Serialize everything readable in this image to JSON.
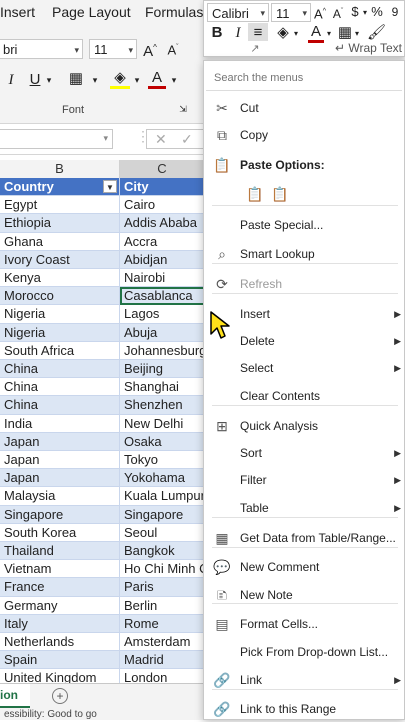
{
  "ribbon": {
    "tabs": [
      "Insert",
      "Page Layout",
      "Formulas"
    ],
    "font_name": "bri",
    "font_size": "11",
    "font_group_label": "Font"
  },
  "mini_toolbar": {
    "font_name": "Calibri",
    "font_size": "11",
    "currency_symbol": "$",
    "percent_symbol": "%",
    "wrap_text_label": "Wrap Text"
  },
  "columns": {
    "b": "B",
    "c": "C"
  },
  "table": {
    "headers": [
      "Country",
      "City"
    ],
    "rows": [
      [
        "Egypt",
        "Cairo"
      ],
      [
        "Ethiopia",
        "Addis Ababa"
      ],
      [
        "Ghana",
        "Accra"
      ],
      [
        "Ivory Coast",
        "Abidjan"
      ],
      [
        "Kenya",
        "Nairobi"
      ],
      [
        "Morocco",
        "Casablanca"
      ],
      [
        "Nigeria",
        "Lagos"
      ],
      [
        "Nigeria",
        "Abuja"
      ],
      [
        "South Africa",
        "Johannesburg"
      ],
      [
        "China",
        "Beijing"
      ],
      [
        "China",
        "Shanghai"
      ],
      [
        "China",
        "Shenzhen"
      ],
      [
        "India",
        "New Delhi"
      ],
      [
        "Japan",
        "Osaka"
      ],
      [
        "Japan",
        "Tokyo"
      ],
      [
        "Japan",
        "Yokohama"
      ],
      [
        "Malaysia",
        "Kuala Lumpur"
      ],
      [
        "Singapore",
        "Singapore"
      ],
      [
        "South Korea",
        "Seoul"
      ],
      [
        "Thailand",
        "Bangkok"
      ],
      [
        "Vietnam",
        "Ho Chi Minh City"
      ],
      [
        "France",
        "Paris"
      ],
      [
        "Germany",
        "Berlin"
      ],
      [
        "Italy",
        "Rome"
      ],
      [
        "Netherlands",
        "Amsterdam"
      ],
      [
        "Spain",
        "Madrid"
      ],
      [
        "United Kingdom",
        "London"
      ]
    ]
  },
  "sheet": {
    "active_tab_fragment": "ion",
    "add_symbol": "+"
  },
  "status": {
    "accessibility": "essibility: Good to go"
  },
  "menu": {
    "search_placeholder": "Search the menus",
    "items": [
      {
        "label": "Cut",
        "icon": "scissors-icon",
        "glyph": "✂",
        "arrow": false,
        "disabled": false
      },
      {
        "label": "Copy",
        "icon": "copy-icon",
        "glyph": "⧉",
        "arrow": false,
        "disabled": false
      },
      {
        "label": "Paste Options:",
        "icon": "paste-icon",
        "glyph": "📋",
        "arrow": false,
        "disabled": false,
        "bold": true
      },
      {
        "label": "Paste Special...",
        "icon": "",
        "glyph": "",
        "arrow": false,
        "disabled": false
      },
      {
        "label": "Smart Lookup",
        "icon": "smart-lookup-icon",
        "glyph": "⌕",
        "arrow": false,
        "disabled": false
      },
      {
        "label": "Refresh",
        "icon": "refresh-icon",
        "glyph": "⟳",
        "arrow": false,
        "disabled": true
      },
      {
        "label": "Insert",
        "icon": "",
        "glyph": "",
        "arrow": true,
        "disabled": false
      },
      {
        "label": "Delete",
        "icon": "",
        "glyph": "",
        "arrow": true,
        "disabled": false
      },
      {
        "label": "Select",
        "icon": "",
        "glyph": "",
        "arrow": true,
        "disabled": false
      },
      {
        "label": "Clear Contents",
        "icon": "",
        "glyph": "",
        "arrow": false,
        "disabled": false
      },
      {
        "label": "Quick Analysis",
        "icon": "quick-analysis-icon",
        "glyph": "⊞",
        "arrow": false,
        "disabled": false
      },
      {
        "label": "Sort",
        "icon": "",
        "glyph": "",
        "arrow": true,
        "disabled": false
      },
      {
        "label": "Filter",
        "icon": "",
        "glyph": "",
        "arrow": true,
        "disabled": false
      },
      {
        "label": "Table",
        "icon": "",
        "glyph": "",
        "arrow": true,
        "disabled": false
      },
      {
        "label": "Get Data from Table/Range...",
        "icon": "table-range-icon",
        "glyph": "▦",
        "arrow": false,
        "disabled": false
      },
      {
        "label": "New Comment",
        "icon": "new-comment-icon",
        "glyph": "💬",
        "arrow": false,
        "disabled": false
      },
      {
        "label": "New Note",
        "icon": "new-note-icon",
        "glyph": "🗈",
        "arrow": false,
        "disabled": false
      },
      {
        "label": "Format Cells...",
        "icon": "format-cells-icon",
        "glyph": "▤",
        "arrow": false,
        "disabled": false
      },
      {
        "label": "Pick From Drop-down List...",
        "icon": "",
        "glyph": "",
        "arrow": false,
        "disabled": false
      },
      {
        "label": "Link",
        "icon": "link-icon",
        "glyph": "🔗",
        "arrow": true,
        "disabled": false
      },
      {
        "label": "Link to this Range",
        "icon": "link-range-icon",
        "glyph": "🔗",
        "arrow": false,
        "disabled": false
      }
    ]
  },
  "colors": {
    "table_header": "#4472c4",
    "band": "#dce6f4",
    "font_color_underline": "#c00000",
    "fill_color_underline": "#ffff00",
    "cursor": "#ffe11a"
  }
}
